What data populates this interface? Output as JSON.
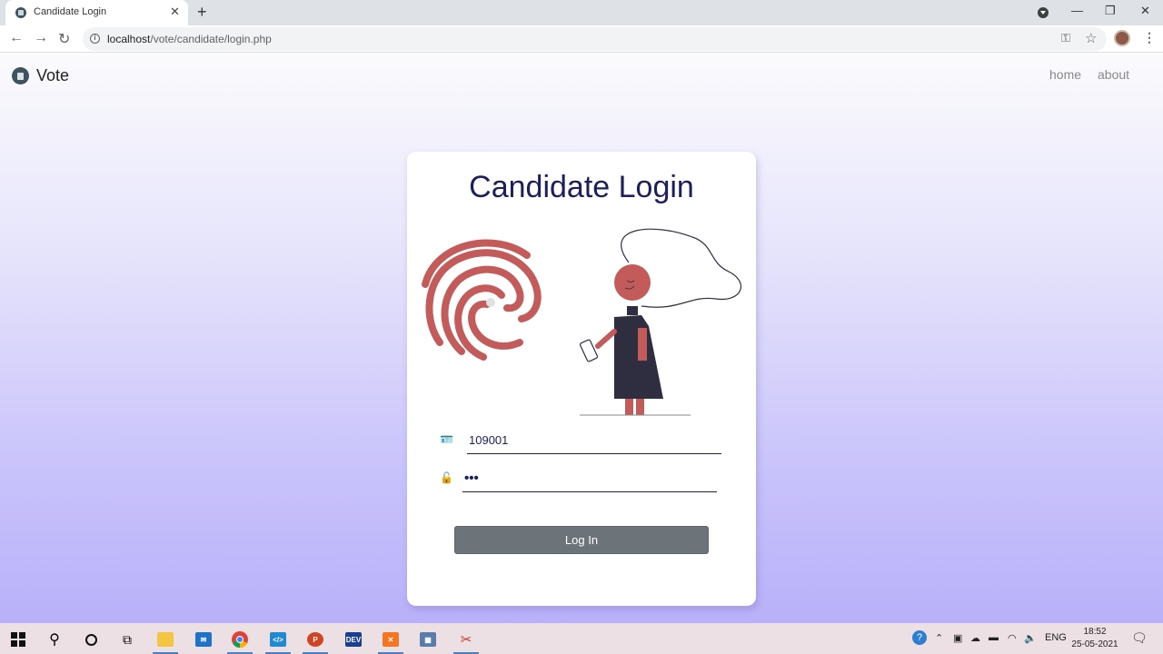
{
  "browser": {
    "tab_title": "Candidate Login",
    "url_host": "localhost",
    "url_path": "/vote/candidate/login.php"
  },
  "navbar": {
    "brand": "Vote",
    "links": [
      "home",
      "about"
    ]
  },
  "login": {
    "title": "Candidate Login",
    "id_value": "109001",
    "password_value": "•••",
    "submit_label": "Log In"
  },
  "taskbar": {
    "lang": "ENG",
    "time": "18:52",
    "date": "25-05-2021"
  },
  "colors": {
    "accent": "#1b1f5c",
    "fingerprint": "#c45b5b",
    "button": "#6c747a",
    "gradient_bottom": "#b9b1f9"
  }
}
